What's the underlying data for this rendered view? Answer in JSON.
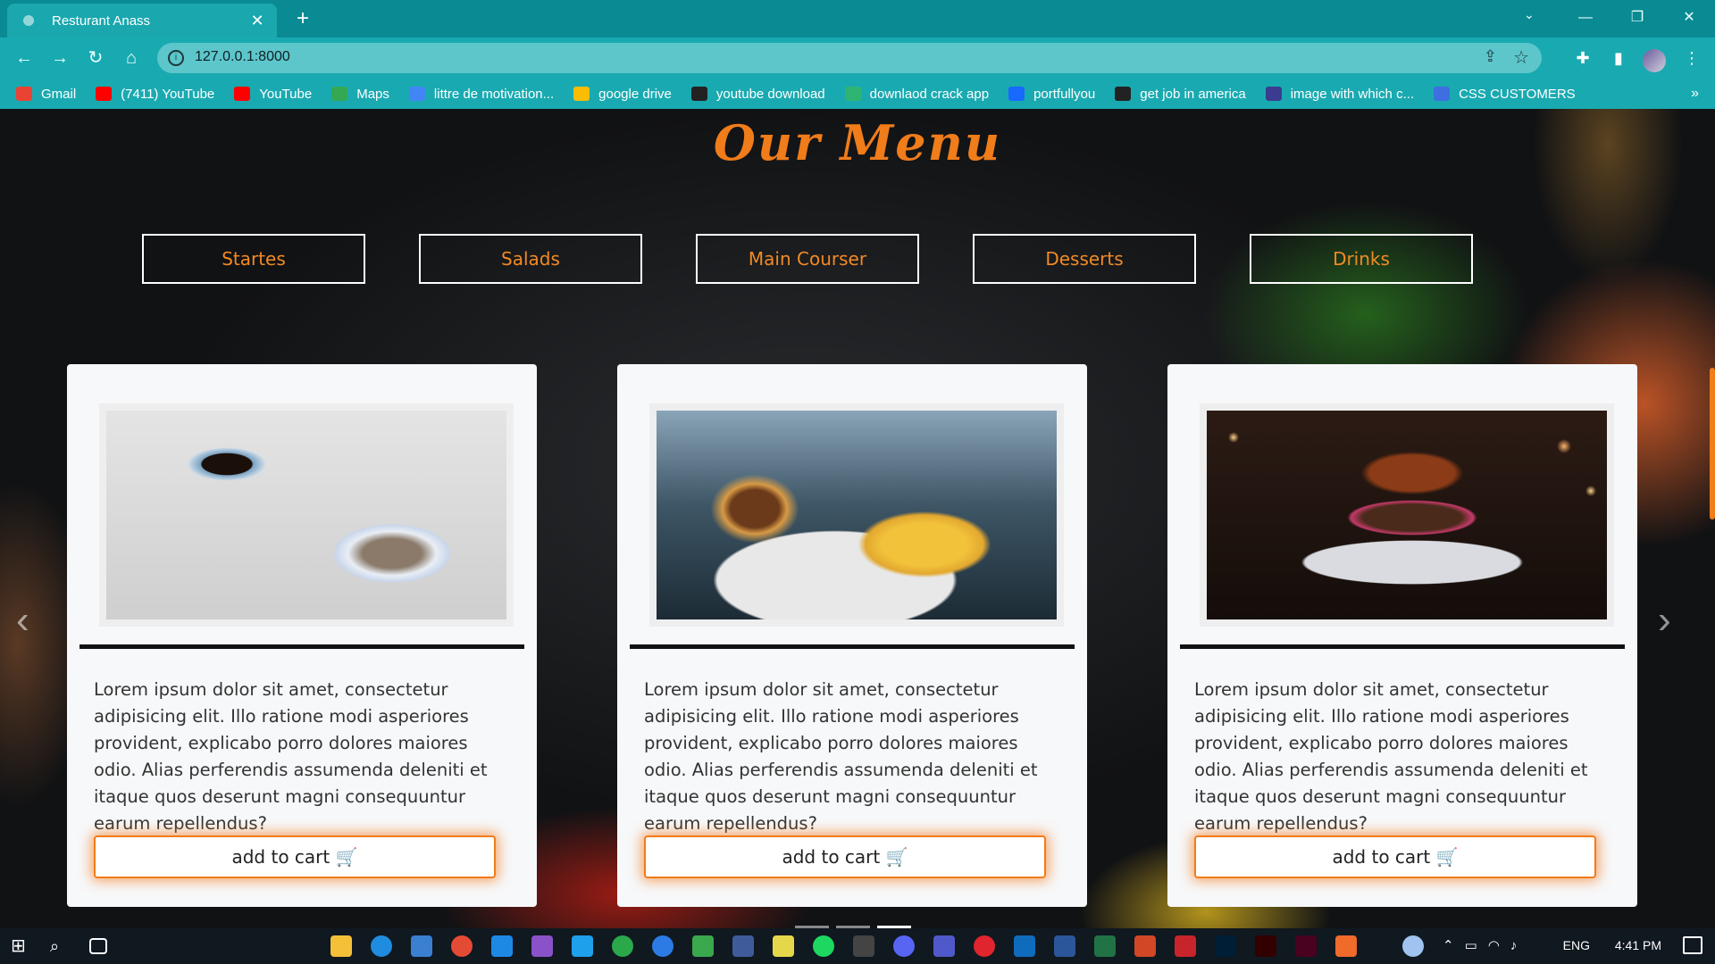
{
  "browser": {
    "tab_title": "Resturant Anass",
    "url": "127.0.0.1:8000",
    "bookmarks": [
      {
        "label": "Gmail",
        "color": "#ea4335"
      },
      {
        "label": "(7411) YouTube",
        "color": "#ff0000"
      },
      {
        "label": "YouTube",
        "color": "#ff0000"
      },
      {
        "label": "Maps",
        "color": "#34a853"
      },
      {
        "label": "littre de motivation...",
        "color": "#4285f4"
      },
      {
        "label": "google drive",
        "color": "#fbbc04"
      },
      {
        "label": "youtube download",
        "color": "#222222"
      },
      {
        "label": "downlaod crack app",
        "color": "#2fb573"
      },
      {
        "label": "portfullyou",
        "color": "#1769ff"
      },
      {
        "label": "get job in america",
        "color": "#222222"
      },
      {
        "label": "image with which c...",
        "color": "#3b3b8f"
      },
      {
        "label": "CSS CUSTOMERS",
        "color": "#3d6fe0"
      }
    ]
  },
  "page": {
    "heading": "Our Menu",
    "categories": [
      "Startes",
      "Salads",
      "Main Courser",
      "Desserts",
      "Drinks"
    ],
    "cards": [
      {
        "description": "Lorem ipsum dolor sit amet, consectetur adipisicing elit. Illo ratione modi asperiores provident, explicabo porro dolores maiores odio. Alias perferendis assumenda deleniti et itaque quos deserunt magni consequuntur earum repellendus?",
        "button": "add to cart 🛒"
      },
      {
        "description": "Lorem ipsum dolor sit amet, consectetur adipisicing elit. Illo ratione modi asperiores provident, explicabo porro dolores maiores odio. Alias perferendis assumenda deleniti et itaque quos deserunt magni consequuntur earum repellendus?",
        "button": "add to cart 🛒"
      },
      {
        "description": "Lorem ipsum dolor sit amet, consectetur adipisicing elit. Illo ratione modi asperiores provident, explicabo porro dolores maiores odio. Alias perferendis assumenda deleniti et itaque quos deserunt magni consequuntur earum repellendus?",
        "button": "add to cart 🛒"
      }
    ],
    "accent_color": "#f07c1a"
  },
  "taskbar": {
    "language": "ENG",
    "time": "4:41 PM"
  }
}
